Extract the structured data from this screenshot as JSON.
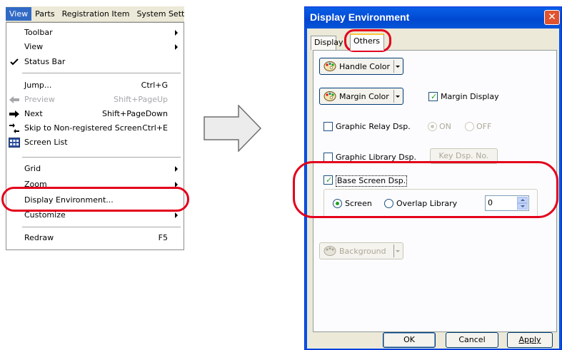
{
  "menubar": {
    "items": [
      "View",
      "Parts",
      "Registration Item",
      "System Sett"
    ]
  },
  "menu": {
    "items": [
      {
        "label": "Toolbar",
        "shortcut": "",
        "submenu": true
      },
      {
        "label": "View",
        "shortcut": "",
        "submenu": true
      },
      {
        "label": "Status Bar",
        "shortcut": "",
        "checked": true
      },
      {
        "label": "Jump...",
        "shortcut": "Ctrl+G"
      },
      {
        "label": "Preview",
        "shortcut": "Shift+PageUp",
        "disabled": true,
        "icon": "arrow-left-icon"
      },
      {
        "label": "Next",
        "shortcut": "Shift+PageDown",
        "icon": "arrow-right-icon"
      },
      {
        "label": "Skip to Non-registered Screen",
        "shortcut": "Ctrl+E",
        "icon": "skip-icon"
      },
      {
        "label": "Screen List",
        "shortcut": "",
        "icon": "screen-list-icon"
      },
      {
        "label": "Grid",
        "shortcut": "",
        "submenu": true
      },
      {
        "label": "Zoom",
        "shortcut": "",
        "submenu": true
      },
      {
        "label": "Display Environment...",
        "shortcut": ""
      },
      {
        "label": "Customize",
        "shortcut": "",
        "submenu": true
      },
      {
        "label": "Redraw",
        "shortcut": "F5"
      }
    ]
  },
  "dialog": {
    "title": "Display Environment",
    "close_glyph": "✕",
    "tabs": [
      "Display",
      "Others"
    ],
    "handle_color": "Handle Color",
    "margin_color": "Margin Color",
    "margin_display": "Margin Display",
    "graphic_relay": "Graphic Relay Dsp.",
    "on_label": "ON",
    "off_label": "OFF",
    "graphic_library": "Graphic Library Dsp.",
    "key_dsp": "Key Dsp. No.",
    "base_screen": "Base Screen Dsp.",
    "screen_radio": "Screen",
    "overlap_radio": "Overlap Library",
    "spin_value": "0",
    "background": "Background",
    "ok": "OK",
    "cancel": "Cancel",
    "apply": "Apply"
  },
  "colors": {
    "highlight": "#e3001b",
    "title_blue": "#0054e3",
    "menu_selected": "#316ac5"
  }
}
